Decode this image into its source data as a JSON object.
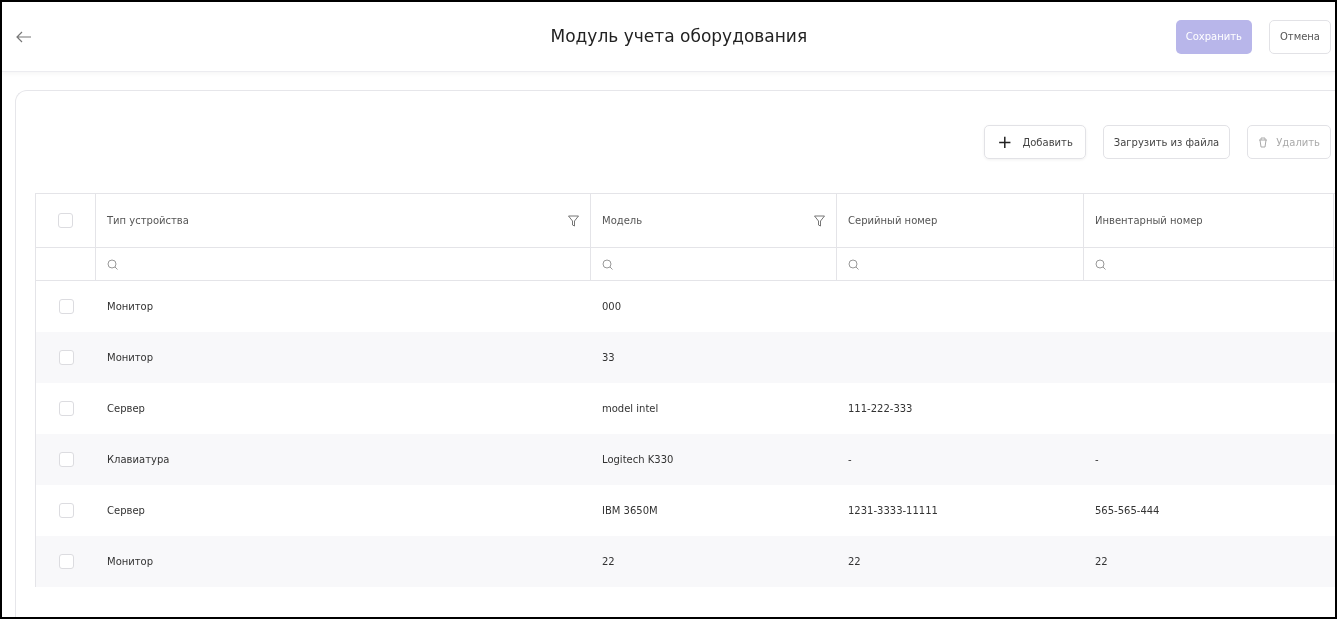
{
  "header": {
    "title": "Модуль учета оборудования",
    "save": {
      "label": "Сохранить",
      "disabled": true
    },
    "cancel": {
      "label": "Отмена"
    }
  },
  "toolbar": {
    "add": {
      "icon": "+",
      "label": "Добавить"
    },
    "upload": {
      "label": "Загрузить из файла"
    },
    "delete": {
      "label": "Удалить",
      "disabled": true
    }
  },
  "table": {
    "all_checked": false,
    "columns": [
      {
        "label": "Тип устройства",
        "filterable": true
      },
      {
        "label": "Модель",
        "filterable": true
      },
      {
        "label": "Серийный номер",
        "filterable": false
      },
      {
        "label": "Инвентарный номер",
        "filterable": false
      }
    ],
    "rows": [
      {
        "checked": false,
        "cells": [
          "Монитор",
          "000",
          "",
          ""
        ]
      },
      {
        "checked": false,
        "cells": [
          "Монитор",
          "33",
          "",
          ""
        ]
      },
      {
        "checked": false,
        "cells": [
          "Сервер",
          "model intel",
          "111-222-333",
          ""
        ]
      },
      {
        "checked": false,
        "cells": [
          "Клавиатура",
          "Logitech K330",
          "-",
          "-"
        ]
      },
      {
        "checked": false,
        "cells": [
          "Сервер",
          "IBM 3650M",
          "1231-3333-11111",
          "565-565-444"
        ]
      },
      {
        "checked": false,
        "cells": [
          "Монитор",
          "22",
          "22",
          "22"
        ]
      }
    ]
  }
}
